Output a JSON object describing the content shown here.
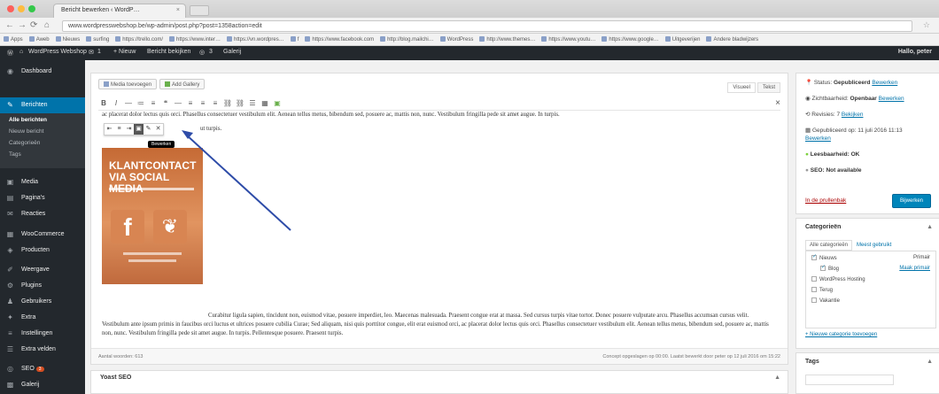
{
  "browser": {
    "tab_title": "Bericht bewerken ‹ WordP…",
    "tab_close": "×",
    "url": "www.wordpresswebshop.be/wp-admin/post.php?post=1358action=edit",
    "bookmarks": [
      "Apps",
      "Aweb",
      "Nieuws",
      "surfing",
      "https://trello.com/",
      "https://www.inter…",
      "https://vn.wordpres…",
      "f",
      "https://www.facebook.com",
      "http://blog.mailchi…",
      "WordPress",
      "http://www.themes…",
      "https://www.youtu…",
      "https://www.google…",
      "Uitgeverijen",
      "Andere bladwijzers"
    ]
  },
  "adminbar": {
    "site": "WordPress Webshop",
    "comments": "1",
    "new": "+ Nieuw",
    "view_post": "Bericht bekijken",
    "seo_count": "3",
    "gallery": "Galerij",
    "howdy": "Hallo, peter"
  },
  "sidebar": {
    "items": [
      {
        "label": "Dashboard",
        "icon": "dashboard-icon",
        "glyph": "◉"
      },
      {
        "label": "Berichten",
        "icon": "pin-icon",
        "glyph": "✎"
      },
      {
        "label": "Media",
        "icon": "media-icon",
        "glyph": "▣"
      },
      {
        "label": "Pagina's",
        "icon": "page-icon",
        "glyph": "▤"
      },
      {
        "label": "Reacties",
        "icon": "comment-icon",
        "glyph": "✉"
      },
      {
        "label": "WooCommerce",
        "icon": "woo-icon",
        "glyph": "▦"
      },
      {
        "label": "Producten",
        "icon": "products-icon",
        "glyph": "◈"
      },
      {
        "label": "Weergave",
        "icon": "appearance-icon",
        "glyph": "✐"
      },
      {
        "label": "Plugins",
        "icon": "plugin-icon",
        "glyph": "⚙"
      },
      {
        "label": "Gebruikers",
        "icon": "users-icon",
        "glyph": "♟"
      },
      {
        "label": "Extra",
        "icon": "tools-icon",
        "glyph": "✦"
      },
      {
        "label": "Instellingen",
        "icon": "settings-icon",
        "glyph": "≡"
      },
      {
        "label": "Extra velden",
        "icon": "fields-icon",
        "glyph": "☰"
      },
      {
        "label": "SEO",
        "icon": "seo-icon",
        "glyph": "◎",
        "badge": "3"
      },
      {
        "label": "Galerij",
        "icon": "gallery-icon",
        "glyph": "▩"
      }
    ],
    "submenu": [
      "Alle berichten",
      "Nieuw bericht",
      "Categorieën",
      "Tags"
    ]
  },
  "editor": {
    "add_media": "Media toevoegen",
    "add_gallery": "Add Gallery",
    "tab_visual": "Visueel",
    "tab_text": "Tekst",
    "toolbar": [
      "B",
      "I",
      "—",
      "≔",
      "≡",
      "❝",
      "—",
      "≡",
      "≡",
      "≡",
      "⛓",
      "⛓",
      "☰",
      "▦",
      "▣"
    ],
    "close": "×",
    "top_text": "ac placerat dolor lectus quis orci. Phasellus consectetuer vestibulum elit. Aenean tellus metus, bibendum sed, posuere ac, mattis non, nunc. Vestibulum fringilla pede sit amet augue. In turpis.",
    "after_tools_text": "ut turpis.",
    "image_tools": [
      "⇤",
      "≡",
      "⇥",
      "▣",
      "✎",
      "✕"
    ],
    "tooltip": "Bewerken",
    "book_title": "KLANTCONTACT VIA SOCIAL MEDIA",
    "bottom_text": "Curabitur ligula sapien, tincidunt non, euismod vitae, posuere imperdiet, leo. Maecenas malesuada. Praesent congue erat at massa. Sed cursus turpis vitae tortor. Donec posuere vulputate arcu. Phasellus accumsan cursus velit. Vestibulum ante ipsum primis in faucibus orci luctus et ultrices posuere cubilia Curae; Sed aliquam, nisi quis porttitor congue, elit erat euismod orci, ac placerat dolor lectus quis orci. Phasellus consectetuer vestibulum elit. Aenean tellus metus, bibendum sed, posuere ac, mattis non, nunc. Vestibulum fringilla pede sit amet augue. In turpis. Pellentesque posuere. Praesent turpis.",
    "word_count": "Aantal woorden: 613",
    "last_modified": "Concept opgeslagen op 00:00. Laatst bewerkt door peter op 12 juli 2016 om 15:22"
  },
  "yoast": {
    "title": "Yoast SEO",
    "toggle": "▲"
  },
  "publish": {
    "status_label": "Status:",
    "status_value": "Gepubliceerd",
    "status_edit": "Bewerken",
    "visibility_label": "Zichtbaarheid:",
    "visibility_value": "Openbaar",
    "visibility_edit": "Bewerken",
    "revisions": "Revisies: 7",
    "revisions_link": "Bekijken",
    "published_on": "Gepubliceerd op: 11 juli 2016 11:13",
    "published_edit": "Bewerken",
    "readability": "Leesbaarheid: OK",
    "seo": "SEO: Not available",
    "trash": "In de prullenbak",
    "update": "Bijwerken"
  },
  "categories": {
    "title": "Categorieën",
    "toggle": "▲",
    "tab_all": "Alle categorieën",
    "tab_popular": "Meest gebruikt",
    "items": [
      {
        "label": "Nieuws",
        "checked": true,
        "right": "Primair"
      },
      {
        "label": "Blog",
        "checked": true,
        "right": "Maak primair"
      },
      {
        "label": "WordPress Hosting",
        "checked": false,
        "right": ""
      },
      {
        "label": "Terug",
        "checked": false,
        "right": ""
      },
      {
        "label": "Vakantie",
        "checked": false,
        "right": ""
      }
    ],
    "add_new": "+ Nieuwe categorie toevoegen"
  },
  "tags": {
    "title": "Tags",
    "toggle": "▲"
  },
  "colors": {
    "accent": "#0073aa",
    "sidebar": "#23282d",
    "active": "#0073aa",
    "arrow": "#2e4ca8"
  }
}
